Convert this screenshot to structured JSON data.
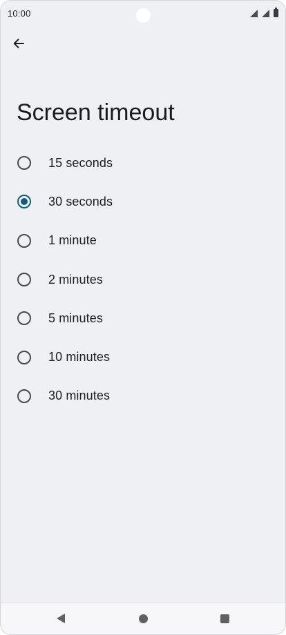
{
  "status_bar": {
    "time": "10:00"
  },
  "header": {
    "back_icon": "arrow-left-icon"
  },
  "page": {
    "title": "Screen timeout"
  },
  "options": [
    {
      "label": "15 seconds",
      "checked": false
    },
    {
      "label": "30 seconds",
      "checked": true
    },
    {
      "label": "1 minute",
      "checked": false
    },
    {
      "label": "2 minutes",
      "checked": false
    },
    {
      "label": "5 minutes",
      "checked": false
    },
    {
      "label": "10 minutes",
      "checked": false
    },
    {
      "label": "30 minutes",
      "checked": false
    }
  ],
  "nav_bar": {
    "back_icon": "triangle-back-icon",
    "home_icon": "circle-home-icon",
    "recents_icon": "square-recents-icon"
  },
  "colors": {
    "background": "#eff0f4",
    "accent": "#0f5f7e",
    "text": "#1f1f22"
  }
}
